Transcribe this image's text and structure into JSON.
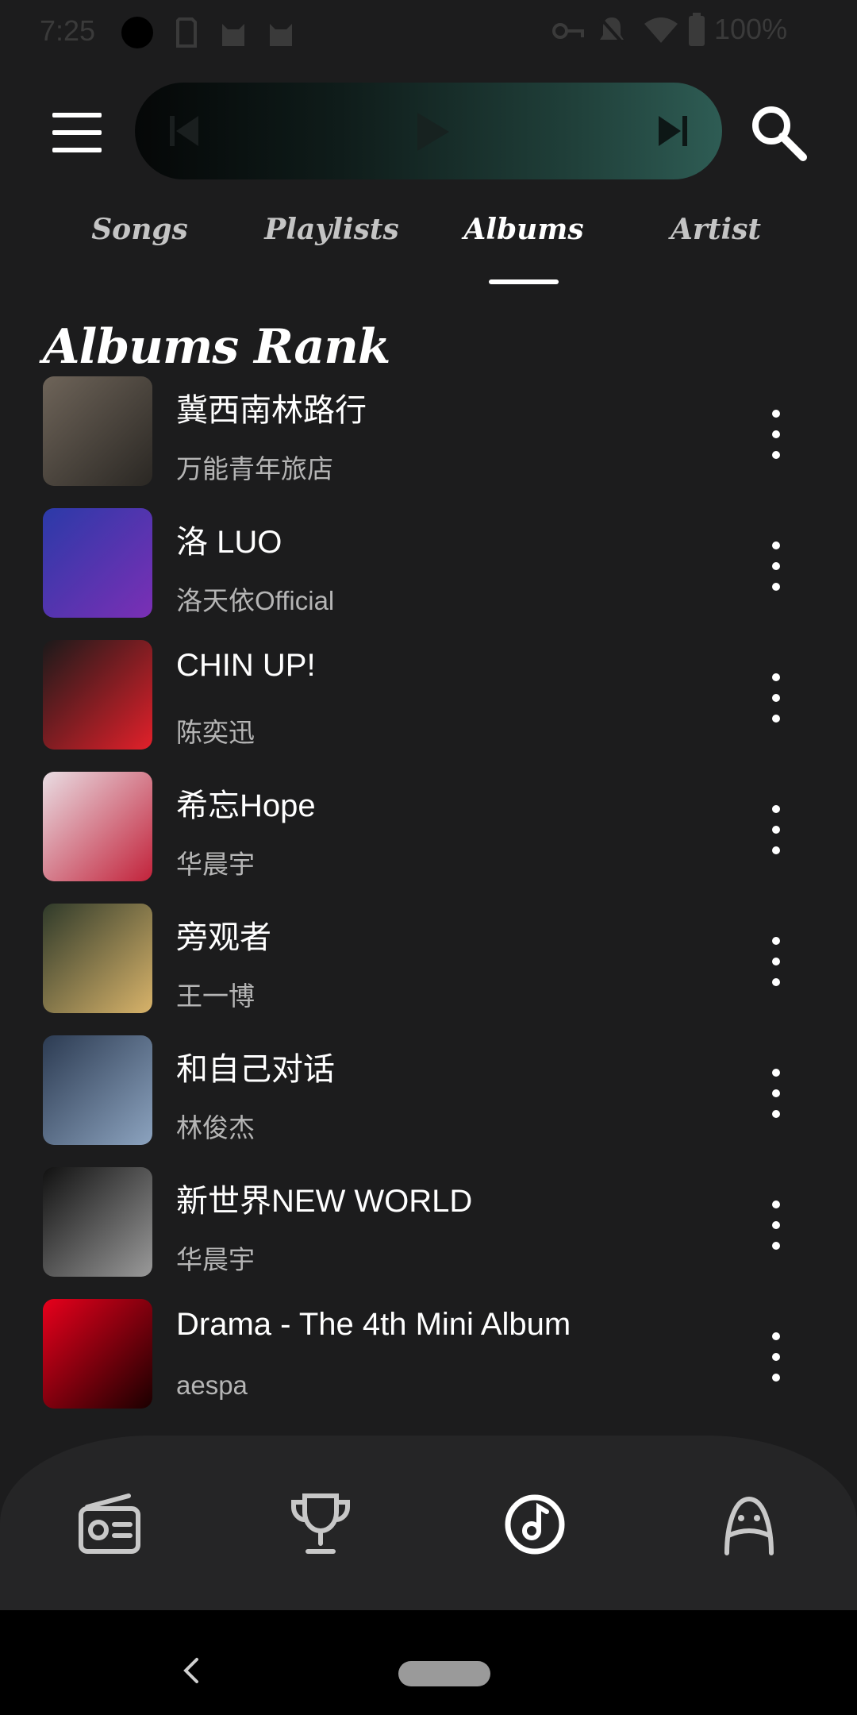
{
  "status_bar": {
    "time": "7:25",
    "battery": "100%"
  },
  "tabs": [
    {
      "label": "Songs",
      "active": false
    },
    {
      "label": "Playlists",
      "active": false
    },
    {
      "label": "Albums",
      "active": true
    },
    {
      "label": "Artist",
      "active": false
    }
  ],
  "section_title": "Albums Rank",
  "albums": [
    {
      "title": "冀西南林路行",
      "artist": "万能青年旅店",
      "cover_colors": [
        "#6e6459",
        "#2a2723"
      ]
    },
    {
      "title": "洛 LUO",
      "artist": "洛天依Official",
      "cover_colors": [
        "#2b3aa8",
        "#7b2fb5"
      ]
    },
    {
      "title": "CHIN UP!",
      "artist": "陈奕迅",
      "cover_colors": [
        "#1a1a1a",
        "#e2202a"
      ]
    },
    {
      "title": "希忘Hope",
      "artist": "华晨宇",
      "cover_colors": [
        "#e9dde3",
        "#c2223a"
      ]
    },
    {
      "title": "旁观者",
      "artist": "王一博",
      "cover_colors": [
        "#2f3a2a",
        "#d8b36a"
      ]
    },
    {
      "title": "和自己对话",
      "artist": "林俊杰",
      "cover_colors": [
        "#2c3b52",
        "#8ca3bf"
      ]
    },
    {
      "title": "新世界NEW WORLD",
      "artist": "华晨宇",
      "cover_colors": [
        "#111111",
        "#9a9a9a"
      ]
    },
    {
      "title": "Drama - The 4th Mini Album",
      "artist": "aespa",
      "cover_colors": [
        "#e8001c",
        "#1a0000"
      ]
    }
  ],
  "bottom_nav": [
    {
      "icon": "radio-icon",
      "active": false
    },
    {
      "icon": "trophy-icon",
      "active": false
    },
    {
      "icon": "music-disc-icon",
      "active": true
    },
    {
      "icon": "profile-icon",
      "active": false
    }
  ],
  "colors": {
    "background": "#1c1c1d",
    "nav_background": "#252526",
    "player_accent": "#2e5c54"
  }
}
